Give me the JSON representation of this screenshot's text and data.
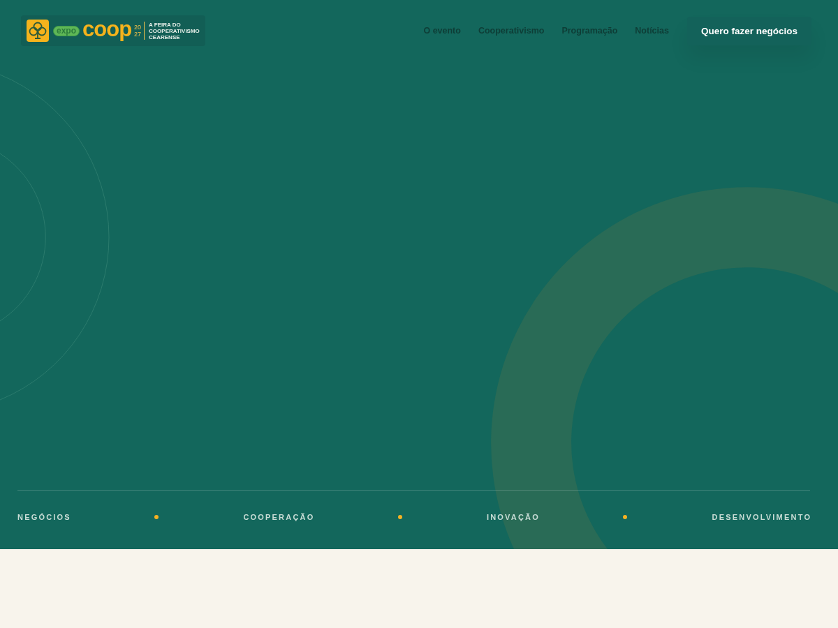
{
  "header": {
    "logo": {
      "tag": "expo",
      "wordmark": "coop",
      "year_lines": [
        "20",
        "27"
      ],
      "tagline_lines": [
        "A FEIRA DO",
        "COOPERATIVISMO",
        "CEARENSE"
      ]
    },
    "nav_links": [
      "O evento",
      "Cooperativismo",
      "Programação",
      "Notícias"
    ],
    "cta_button": "Quero fazer negócios"
  },
  "pillars": [
    "NEGÓCIOS",
    "COOPERAÇÃO",
    "INOVAÇÃO",
    "DESENVOLVIMENTO"
  ]
}
